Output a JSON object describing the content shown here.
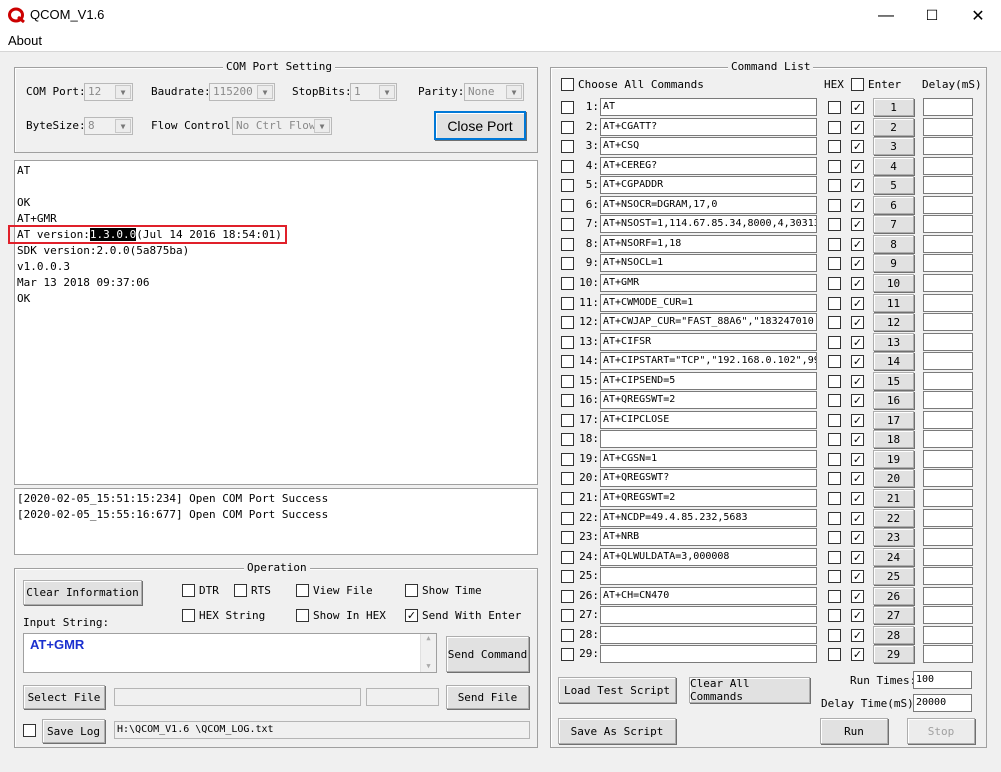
{
  "window": {
    "title": "QCOM_V1.6",
    "minimize": "—",
    "maximize": "☐",
    "close": "✕"
  },
  "menu": {
    "about": "About"
  },
  "com_settings": {
    "title": "COM Port Setting",
    "com_port_label": "COM Port:",
    "com_port_value": "12",
    "baudrate_label": "Baudrate:",
    "baudrate_value": "115200",
    "stopbits_label": "StopBits:",
    "stopbits_value": "1",
    "parity_label": "Parity:",
    "parity_value": "None",
    "bytesize_label": "ByteSize:",
    "bytesize_value": "8",
    "flow_label": "Flow Control:",
    "flow_value": "No Ctrl Flow",
    "close_port": "Close Port"
  },
  "terminal": {
    "lines": [
      "AT",
      "",
      "OK",
      "AT+GMR"
    ],
    "highlight_prefix": "AT version:",
    "highlight_selected": "1.3.0.0",
    "highlight_suffix": "(Jul 14 2016 18:54:01)",
    "after_lines": [
      "SDK version:2.0.0(5a875ba)",
      "v1.0.0.3",
      "Mar 13 2018 09:37:06",
      "OK"
    ],
    "highlight_color": "#e0202a"
  },
  "log": {
    "lines": [
      "[2020-02-05_15:51:15:234] Open COM Port Success",
      "[2020-02-05_15:55:16:677] Open COM Port Success"
    ]
  },
  "operation": {
    "title": "Operation",
    "clear_info": "Clear Information",
    "dtr": "DTR",
    "rts": "RTS",
    "view_file": "View File",
    "show_time": "Show Time",
    "hex_string": "HEX String",
    "show_in_hex": "Show In HEX",
    "send_with_enter": "Send With Enter",
    "input_label": "Input String:",
    "input_value": "AT+GMR",
    "send_command": "Send Command",
    "select_file": "Select File",
    "send_file": "Send File",
    "save_log": "Save Log",
    "log_path": "H:\\QCOM_V1.6 \\QCOM_LOG.txt"
  },
  "command_list": {
    "title": "Command List",
    "choose_all": "Choose All Commands",
    "hex_header": "HEX",
    "enter_header": "Enter",
    "delay_header": "Delay(mS)",
    "rows": [
      {
        "num": "1:",
        "cmd": "AT",
        "btn": "1"
      },
      {
        "num": "2:",
        "cmd": "AT+CGATT?",
        "btn": "2"
      },
      {
        "num": "3:",
        "cmd": "AT+CSQ",
        "btn": "3"
      },
      {
        "num": "4:",
        "cmd": "AT+CEREG?",
        "btn": "4"
      },
      {
        "num": "5:",
        "cmd": "AT+CGPADDR",
        "btn": "5"
      },
      {
        "num": "6:",
        "cmd": "AT+NSOCR=DGRAM,17,0",
        "btn": "6"
      },
      {
        "num": "7:",
        "cmd": "AT+NSOST=1,114.67.85.34,8000,4,30313",
        "btn": "7"
      },
      {
        "num": "8:",
        "cmd": "AT+NSORF=1,18",
        "btn": "8"
      },
      {
        "num": "9:",
        "cmd": "AT+NSOCL=1",
        "btn": "9"
      },
      {
        "num": "10:",
        "cmd": "AT+GMR",
        "btn": "10"
      },
      {
        "num": "11:",
        "cmd": "AT+CWMODE_CUR=1",
        "btn": "11"
      },
      {
        "num": "12:",
        "cmd": "AT+CWJAP_CUR=\"FAST_88A6\",\"183247010",
        "btn": "12"
      },
      {
        "num": "13:",
        "cmd": "AT+CIFSR",
        "btn": "13"
      },
      {
        "num": "14:",
        "cmd": "AT+CIPSTART=\"TCP\",\"192.168.0.102\",99",
        "btn": "14"
      },
      {
        "num": "15:",
        "cmd": "AT+CIPSEND=5",
        "btn": "15"
      },
      {
        "num": "16:",
        "cmd": "AT+QREGSWT=2",
        "btn": "16"
      },
      {
        "num": "17:",
        "cmd": "AT+CIPCLOSE",
        "btn": "17"
      },
      {
        "num": "18:",
        "cmd": "",
        "btn": "18"
      },
      {
        "num": "19:",
        "cmd": "AT+CGSN=1",
        "btn": "19"
      },
      {
        "num": "20:",
        "cmd": "AT+QREGSWT?",
        "btn": "20"
      },
      {
        "num": "21:",
        "cmd": "AT+QREGSWT=2",
        "btn": "21"
      },
      {
        "num": "22:",
        "cmd": "AT+NCDP=49.4.85.232,5683",
        "btn": "22"
      },
      {
        "num": "23:",
        "cmd": "AT+NRB",
        "btn": "23"
      },
      {
        "num": "24:",
        "cmd": "AT+QLWULDATA=3,000008",
        "btn": "24"
      },
      {
        "num": "25:",
        "cmd": "",
        "btn": "25"
      },
      {
        "num": "26:",
        "cmd": "AT+CH=CN470",
        "btn": "26"
      },
      {
        "num": "27:",
        "cmd": "",
        "btn": "27"
      },
      {
        "num": "28:",
        "cmd": "",
        "btn": "28"
      },
      {
        "num": "29:",
        "cmd": "",
        "btn": "29"
      }
    ],
    "load_script": "Load Test Script",
    "clear_all": "Clear All Commands",
    "save_script": "Save As Script",
    "run_times_label": "Run Times:",
    "run_times_value": "100",
    "delay_time_label": "Delay Time(mS):",
    "delay_time_value": "20000",
    "run": "Run",
    "stop": "Stop"
  }
}
